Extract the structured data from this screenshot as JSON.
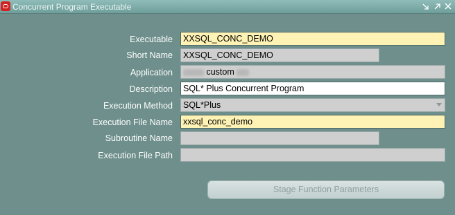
{
  "window": {
    "title": "Concurrent Program Executable",
    "controls": [
      "minimize-icon",
      "maximize-icon",
      "close-icon"
    ]
  },
  "form": {
    "executable": {
      "label": "Executable",
      "value": "XXSQL_CONC_DEMO"
    },
    "short_name": {
      "label": "Short Name",
      "value": "XXSQL_CONC_DEMO"
    },
    "application": {
      "label": "Application",
      "value": "custom"
    },
    "description": {
      "label": "Description",
      "value": "SQL* Plus Concurrent Program"
    },
    "execution_method": {
      "label": "Execution Method",
      "value": "SQL*Plus"
    },
    "execution_file_name": {
      "label": "Execution File Name",
      "value": "xxsql_conc_demo"
    },
    "subroutine_name": {
      "label": "Subroutine Name",
      "value": ""
    },
    "execution_file_path": {
      "label": "Execution File Path",
      "value": ""
    }
  },
  "buttons": {
    "stage_function_parameters": "Stage Function Parameters"
  },
  "colors": {
    "background": "#6e8f8c",
    "required_field": "#fef2b4",
    "readonly_field": "#cfcfcf",
    "editable_field": "#ffffff"
  }
}
